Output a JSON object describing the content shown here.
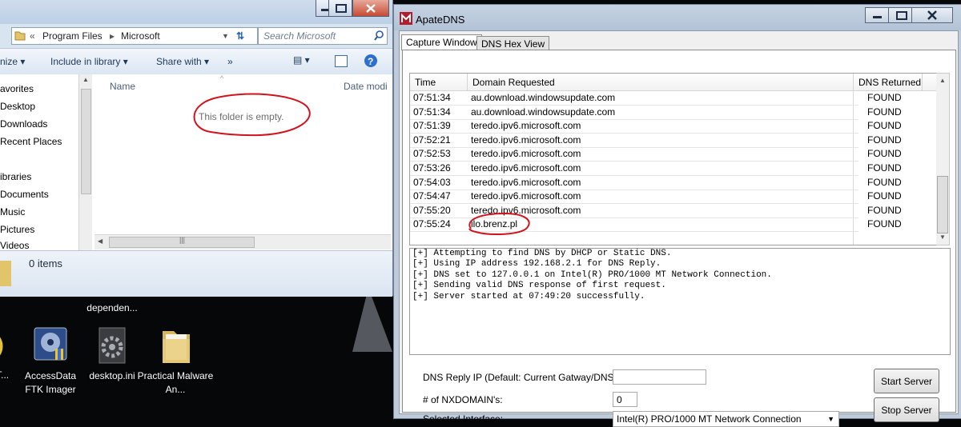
{
  "desktop": {
    "icons": [
      {
        "label": "dependen...",
        "icon": "folder-icon"
      },
      {
        "label": "AT...",
        "icon": "app-icon"
      },
      {
        "label": "AccessData FTK Imager",
        "icon": "ftk-imager-icon"
      },
      {
        "label": "desktop.ini",
        "icon": "settings-file-icon"
      },
      {
        "label": "Practical Malware An...",
        "icon": "folder-icon"
      }
    ]
  },
  "explorer": {
    "address": {
      "seg1": "Program Files",
      "seg2": "Microsoft",
      "prefix": "«"
    },
    "search_placeholder": "Search Microsoft",
    "toolbar": {
      "organize": "nize",
      "include": "Include in library",
      "share": "Share with",
      "more": "»"
    },
    "nav_items": [
      "avorites",
      "Desktop",
      "Downloads",
      "Recent Places",
      "ibraries",
      "Documents",
      "Music",
      "Pictures",
      "Videos"
    ],
    "columns": {
      "name": "Name",
      "date": "Date modi"
    },
    "empty_text": "This folder is empty.",
    "status": "0 items"
  },
  "apate": {
    "title": "ApateDNS",
    "tabs": [
      "Capture Window",
      "DNS Hex View"
    ],
    "grid_headers": {
      "time": "Time",
      "domain": "Domain Requested",
      "dns": "DNS Returned"
    },
    "rows": [
      {
        "time": "07:51:34",
        "domain": "au.download.windowsupdate.com",
        "status": "FOUND"
      },
      {
        "time": "07:51:34",
        "domain": "au.download.windowsupdate.com",
        "status": "FOUND"
      },
      {
        "time": "07:51:39",
        "domain": "teredo.ipv6.microsoft.com",
        "status": "FOUND"
      },
      {
        "time": "07:52:21",
        "domain": "teredo.ipv6.microsoft.com",
        "status": "FOUND"
      },
      {
        "time": "07:52:53",
        "domain": "teredo.ipv6.microsoft.com",
        "status": "FOUND"
      },
      {
        "time": "07:53:26",
        "domain": "teredo.ipv6.microsoft.com",
        "status": "FOUND"
      },
      {
        "time": "07:54:03",
        "domain": "teredo.ipv6.microsoft.com",
        "status": "FOUND"
      },
      {
        "time": "07:54:47",
        "domain": "teredo.ipv6.microsoft.com",
        "status": "FOUND"
      },
      {
        "time": "07:55:20",
        "domain": "teredo.ipv6.microsoft.com",
        "status": "FOUND"
      },
      {
        "time": "07:55:24",
        "domain": "ilo.brenz.pl",
        "status": "FOUND"
      }
    ],
    "log": [
      "[+] Attempting to find DNS by DHCP or Static DNS.",
      "[+] Using IP address 192.168.2.1 for DNS Reply.",
      "[+] DNS set to 127.0.0.1 on Intel(R) PRO/1000 MT Network Connection.",
      "[+] Sending valid DNS response of first request.",
      "[+] Server started at 07:49:20 successfully."
    ],
    "form": {
      "reply_ip_label": "DNS Reply IP (Default: Current Gatway/DNS):",
      "reply_ip_value": "",
      "nxdomain_label": "# of NXDOMAIN's:",
      "nxdomain_value": "0",
      "interface_label": "Selected Interface:",
      "interface_value": "Intel(R) PRO/1000 MT Network Connection"
    },
    "buttons": {
      "start": "Start Server",
      "stop": "Stop Server"
    }
  },
  "colors": {
    "annotation_red": "#d2121c",
    "title_bg": "#b3c3d6"
  }
}
